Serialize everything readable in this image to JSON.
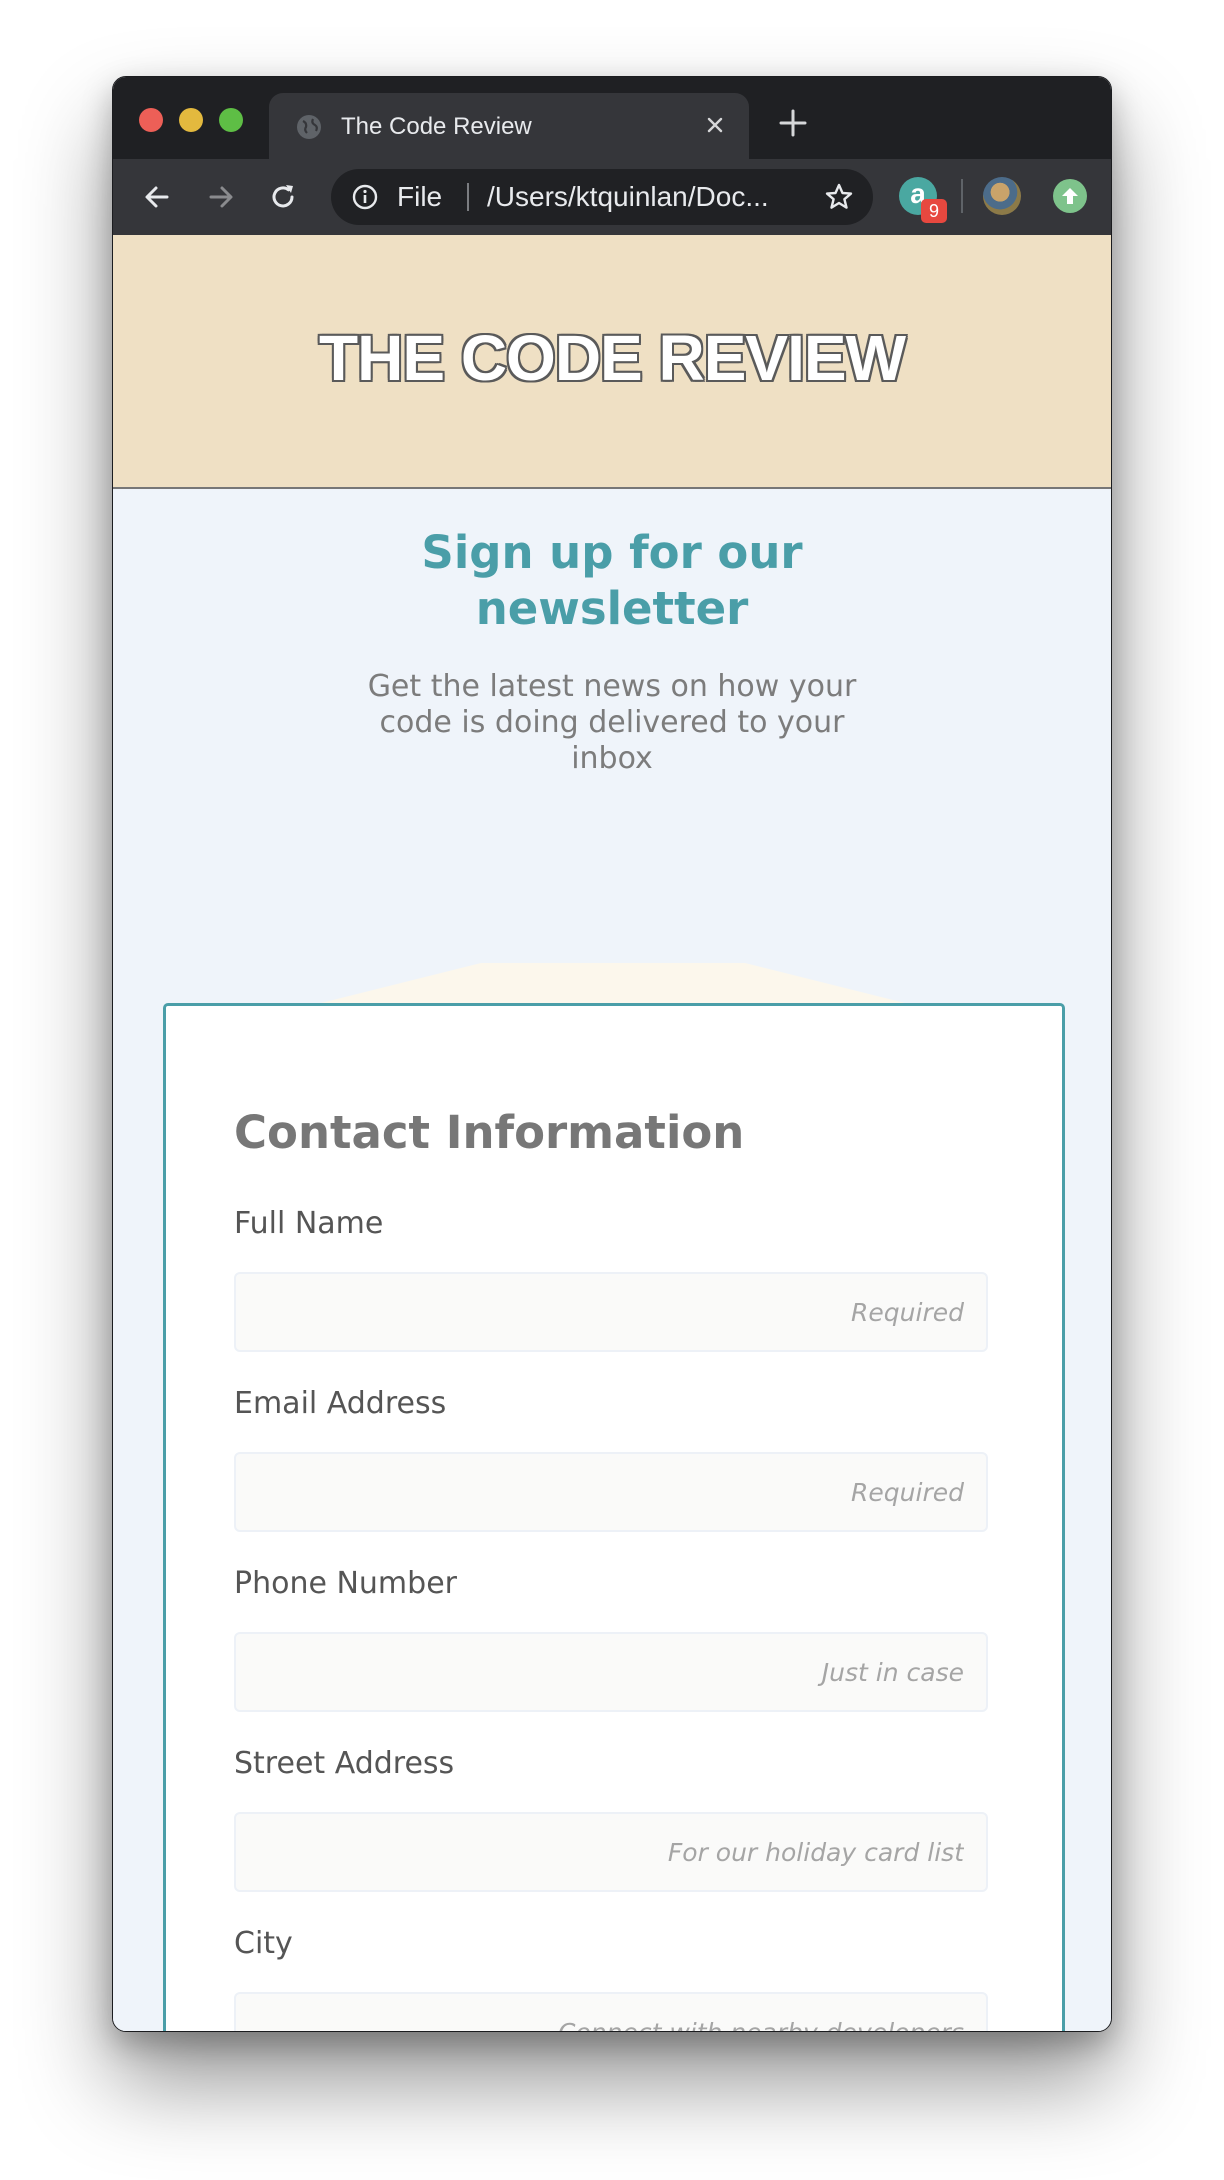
{
  "browser": {
    "tab_title": "The Code Review",
    "address_scheme": "File",
    "address_url": "/Users/ktquinlan/Doc...",
    "extension_letter": "a",
    "extension_badge": "9"
  },
  "banner": {
    "title": "THE CODE REVIEW"
  },
  "signup": {
    "title": "Sign up for our newsletter",
    "subtitle": "Get the latest news on how your code is doing delivered to your inbox"
  },
  "form": {
    "title": "Contact Information",
    "fields": [
      {
        "label": "Full Name",
        "placeholder": "Required"
      },
      {
        "label": "Email Address",
        "placeholder": "Required"
      },
      {
        "label": "Phone Number",
        "placeholder": "Just in case"
      },
      {
        "label": "Street Address",
        "placeholder": "For our holiday card list"
      },
      {
        "label": "City",
        "placeholder": "Connect with nearby developers"
      }
    ]
  },
  "colors": {
    "accent": "#4a9ea8",
    "banner_bg": "#efe0c4",
    "page_bg": "#eff4fa"
  }
}
